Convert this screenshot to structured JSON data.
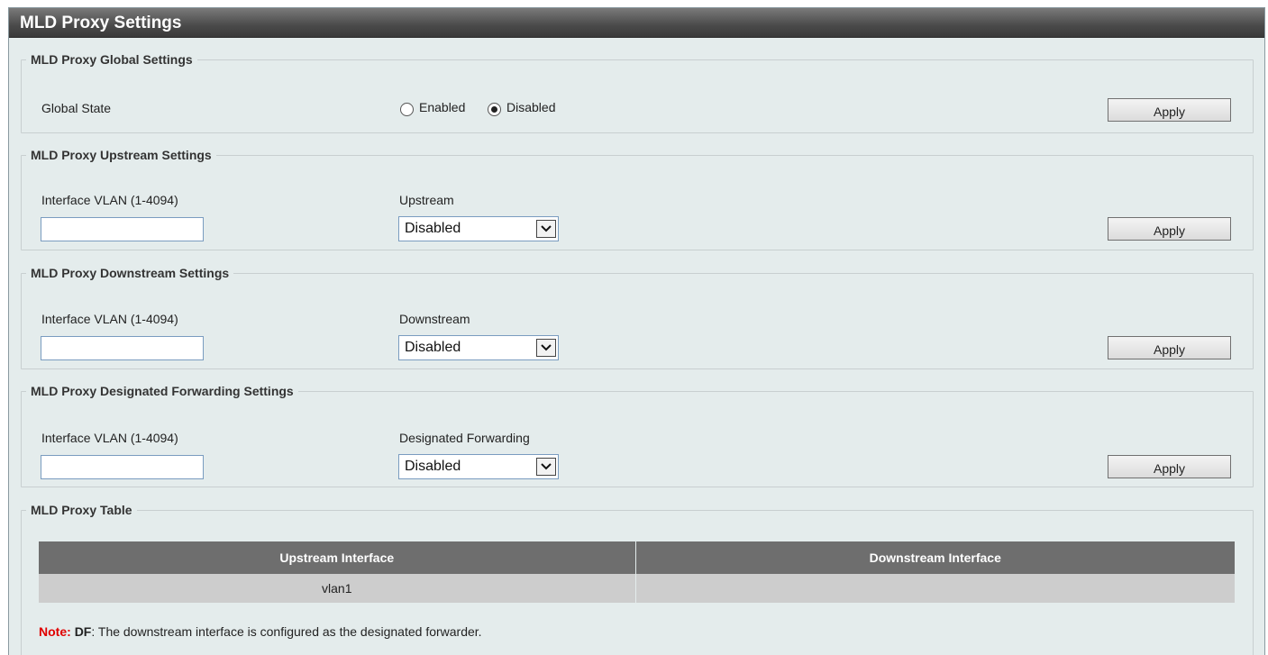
{
  "page": {
    "title": "MLD Proxy Settings"
  },
  "global": {
    "legend": "MLD Proxy Global Settings",
    "state_label": "Global State",
    "enabled_label": "Enabled",
    "disabled_label": "Disabled",
    "selected": "Disabled",
    "apply_label": "Apply"
  },
  "upstream": {
    "legend": "MLD Proxy Upstream Settings",
    "vlan_label": "Interface VLAN (1-4094)",
    "vlan_value": "",
    "select_label": "Upstream",
    "select_value": "Disabled",
    "apply_label": "Apply"
  },
  "downstream": {
    "legend": "MLD Proxy Downstream Settings",
    "vlan_label": "Interface VLAN (1-4094)",
    "vlan_value": "",
    "select_label": "Downstream",
    "select_value": "Disabled",
    "apply_label": "Apply"
  },
  "designated": {
    "legend": "MLD Proxy Designated Forwarding Settings",
    "vlan_label": "Interface VLAN (1-4094)",
    "vlan_value": "",
    "select_label": "Designated Forwarding",
    "select_value": "Disabled",
    "apply_label": "Apply"
  },
  "table": {
    "legend": "MLD Proxy Table",
    "columns": [
      "Upstream Interface",
      "Downstream Interface"
    ],
    "rows": [
      [
        "vlan1",
        ""
      ]
    ]
  },
  "note": {
    "label": "Note",
    "sep": ":",
    "df": "DF",
    "text": ": The downstream interface is configured as the designated forwarder."
  },
  "colors": {
    "title_bar": "#4a4a4a",
    "panel_bg": "#e4ecec",
    "note_red": "#e00000",
    "table_header": "#6e6e6e",
    "table_row": "#cdcdcd"
  }
}
